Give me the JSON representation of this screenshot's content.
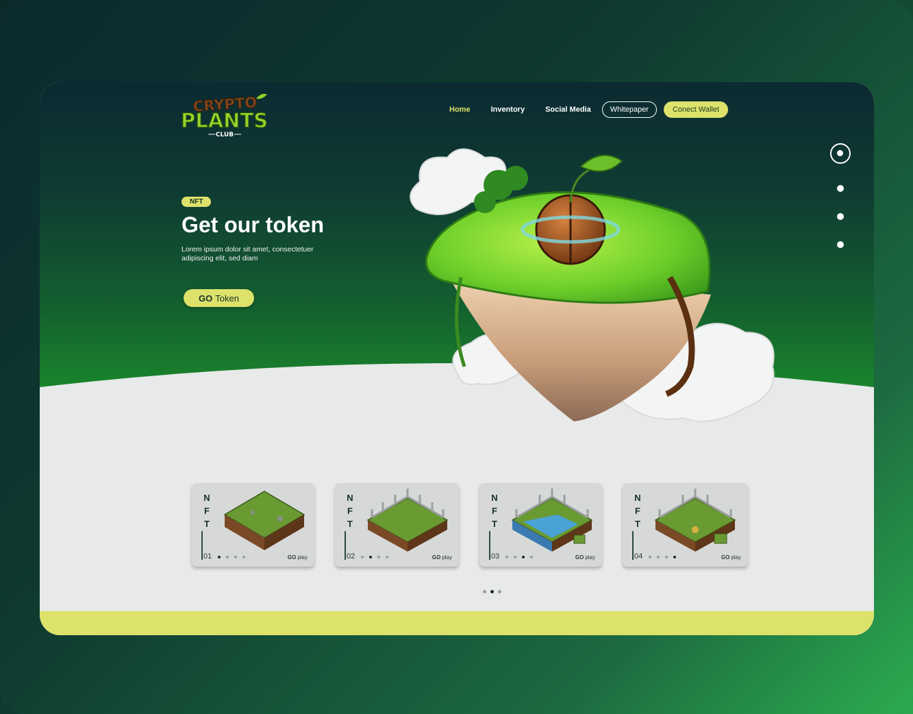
{
  "brand": {
    "line1": "CRYPTO",
    "line2": "PLANTS",
    "line3": "CLUB"
  },
  "nav": {
    "items": [
      "Home",
      "Inventory",
      "Social Media"
    ],
    "active": "Home",
    "whitepaper": "Whitepaper",
    "connect": "Conect Wallet"
  },
  "hero": {
    "badge": "NFT",
    "title": "Get our token",
    "subtitle": "Lorem ipsum dolor sit amet, consectetuer adipiscing elit, sed diam",
    "cta_strong": "GO",
    "cta_text": "Token"
  },
  "cards": [
    {
      "label": "NFT",
      "number": "01",
      "play_strong": "GO",
      "play_text": "play",
      "active_dot": 0,
      "variant": "plain"
    },
    {
      "label": "NFT",
      "number": "02",
      "play_strong": "GO",
      "play_text": "play",
      "active_dot": 1,
      "variant": "fence"
    },
    {
      "label": "NFT",
      "number": "03",
      "play_strong": "GO",
      "play_text": "play",
      "active_dot": 2,
      "variant": "water"
    },
    {
      "label": "NFT",
      "number": "04",
      "play_strong": "GO",
      "play_text": "play",
      "active_dot": 3,
      "variant": "rocks"
    }
  ],
  "carousel": {
    "count": 3,
    "active": 1
  },
  "side_pager": {
    "count": 4,
    "active": 0
  },
  "colors": {
    "accent": "#dde26a",
    "dark": "#0c2a31",
    "green": "#1a8c2a",
    "light": "#e8e9e9"
  }
}
